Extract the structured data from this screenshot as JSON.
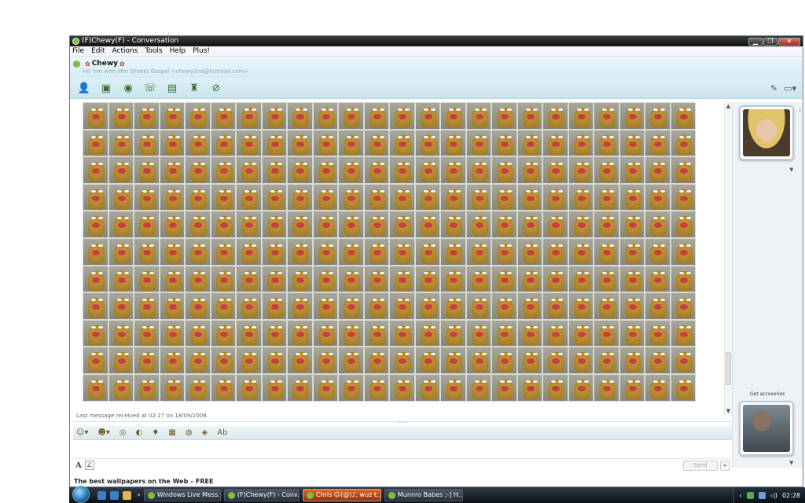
{
  "window": {
    "title": "(F)Chewy(F) - Conversation",
    "controls": {
      "minimize": "▁",
      "maximize": "❐",
      "close": "✕"
    }
  },
  "menu": [
    "File",
    "Edit",
    "Actions",
    "Tools",
    "Help",
    "Plus!"
  ],
  "contact": {
    "name": "Chewy",
    "status_message": "Hit 'em with litte Ghetto Gospel <chewy2nd@hotmail.com>"
  },
  "toolbar": {
    "icons": [
      "invite-contact-icon",
      "share-files-icon",
      "video-call-icon",
      "call-icon",
      "activities-icon",
      "games-icon",
      "block-icon"
    ],
    "right_icons": [
      "backgrounds-icon",
      "display-options-icon"
    ]
  },
  "chat": {
    "emoticon_count": 264,
    "emoticon_name": "chewy-emoticon",
    "last_message": "Last message received at 02:27 on 18/09/2008."
  },
  "format_toolbar": {
    "icons": [
      "emoticon-icon",
      "wink-icon",
      "nudge-icon",
      "voice-clip-icon",
      "image-icon",
      "background-icon",
      "photo-icon",
      "font-icon",
      "text-format-icon"
    ]
  },
  "compose": {
    "font_label": "A",
    "ink_label": "∠",
    "send_label": "Send",
    "send_options_label": "▸"
  },
  "ad": {
    "text": "The best wallpapers on the Web – FREE"
  },
  "right_panel": {
    "get_accessories": "Get accesories"
  },
  "taskbar": {
    "items": [
      {
        "label": "Windows Live Mess...",
        "active": false
      },
      {
        "label": "(F)Chewy(F) - Conv...",
        "active": false
      },
      {
        "label": "Chris ☺(@)♪, wuz t...",
        "active": true
      },
      {
        "label": "Munnro Babes ;-] H...",
        "active": false
      }
    ],
    "clock": "02:28"
  }
}
